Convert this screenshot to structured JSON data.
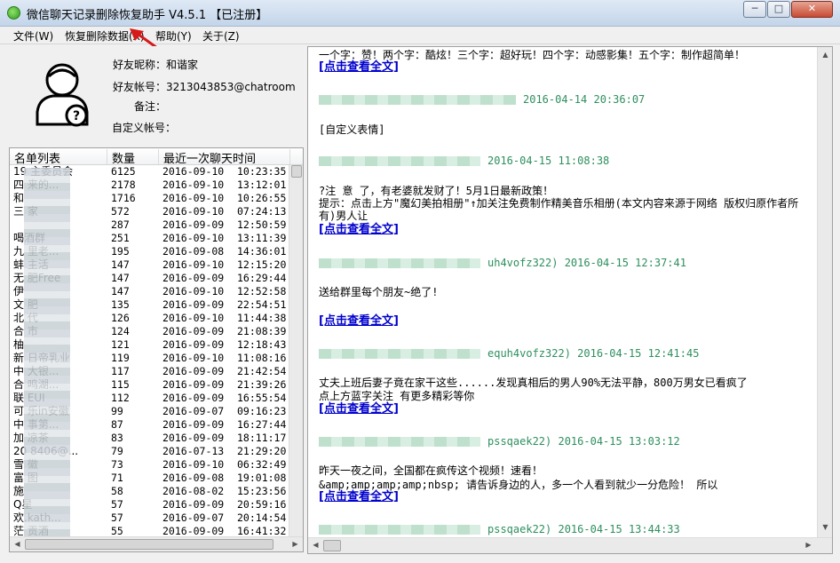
{
  "window": {
    "title": "微信聊天记录删除恢复助手 V4.5.1 【已注册】",
    "min_label": "─",
    "max_label": "□",
    "close_label": "✕"
  },
  "menu": [
    "文件(W)",
    "恢复删除数据(X)",
    "帮助(Y)",
    "关于(Z)"
  ],
  "profile": {
    "nickname_label": "好友昵称：",
    "nickname": "和谐家",
    "account_label": "好友帐号：",
    "account": "3213043853@chatroom",
    "note_label": "备注：",
    "note": "",
    "custom_label": "自定义帐号：",
    "custom": ""
  },
  "list": {
    "headers": [
      "名单列表",
      "数量",
      "最近一次聊天时间"
    ],
    "rows": [
      [
        "19  主委员会",
        "6125",
        "2016-09-10",
        "10:23:35"
      ],
      [
        "四  来的...",
        "2178",
        "2016-09-10",
        "13:12:01"
      ],
      [
        "和",
        "1716",
        "2016-09-10",
        "10:26:55"
      ],
      [
        "三  家",
        "572",
        "2016-09-10",
        "07:24:13"
      ],
      [
        "",
        "287",
        "2016-09-09",
        "12:50:59"
      ],
      [
        "  喝酒群",
        "251",
        "2016-09-10",
        "13:11:39"
      ],
      [
        "九  里老...",
        "195",
        "2016-09-08",
        "14:36:01"
      ],
      [
        "蚌  主活",
        "147",
        "2016-09-10",
        "12:15:20"
      ],
      [
        "无  肥Free",
        "147",
        "2016-09-09",
        "16:29:44"
      ],
      [
        "伊",
        "147",
        "2016-09-10",
        "12:52:58"
      ],
      [
        "文  肥",
        "135",
        "2016-09-09",
        "22:54:51"
      ],
      [
        "北  代",
        "126",
        "2016-09-10",
        "11:44:38"
      ],
      [
        "合  市",
        "124",
        "2016-09-09",
        "21:08:39"
      ],
      [
        "柚",
        "121",
        "2016-09-09",
        "12:18:43"
      ],
      [
        "新  日帝乳业",
        "119",
        "2016-09-10",
        "11:08:16"
      ],
      [
        "中  大银...",
        "117",
        "2016-09-09",
        "21:42:54"
      ],
      [
        "合  鸣湖...",
        "115",
        "2016-09-09",
        "21:39:26"
      ],
      [
        "联  EUI",
        "112",
        "2016-09-09",
        "16:55:54"
      ],
      [
        "可  乐in安徽",
        "99",
        "2016-09-07",
        "09:16:23"
      ],
      [
        "中  事第...",
        "87",
        "2016-09-09",
        "16:27:44"
      ],
      [
        "加  凉茶",
        "83",
        "2016-09-09",
        "18:11:17"
      ],
      [
        "20  8406@...",
        "79",
        "2016-07-13",
        "21:29:20"
      ],
      [
        "雪  徽",
        "73",
        "2016-09-10",
        "06:32:49"
      ],
      [
        "富  图",
        "71",
        "2016-09-08",
        "19:01:08"
      ],
      [
        "施",
        "58",
        "2016-08-02",
        "15:23:56"
      ],
      [
        "  Q星",
        "57",
        "2016-09-09",
        "20:59:16"
      ],
      [
        "  欢.kath...",
        "57",
        "2016-09-07",
        "20:14:54"
      ],
      [
        "茫  贡酒",
        "55",
        "2016-09-09",
        "16:41:32"
      ]
    ]
  },
  "messages": {
    "line1": "一个字：赞！两个字：酷炫！三个字：超好玩！四个字：动感影集！五个字：制作超简单！",
    "view_full": "[点击查看全文]",
    "h1": "2016-04-14 20:36:07",
    "emoji_label": "[自定义表情]",
    "h2": "2016-04-15 11:08:38",
    "line2": "?注 意 了，有老婆就发财了！5月1日最新政策！",
    "line3": "提示：点击上方\"魔幻美拍相册\"↑加关注免费制作精美音乐相册(本文内容来源于网络 版权归原作者所有)男人让",
    "h3": "uh4vofz322) 2016-04-15 12:37:41",
    "line4": "送给群里每个朋友~绝了!",
    "h4": "equh4vofz322) 2016-04-15 12:41:45",
    "line5": "丈夫上班后妻子竟在家干这些......发现真相后的男人90%无法平静，800万男女已看疯了",
    "line6": "点上方蓝字关注 有更多精彩等你",
    "h5": "pssqaek22) 2016-04-15 13:03:12",
    "line7": "昨天一夜之间，全国都在疯传这个视频！速看！",
    "line8": "&amp;amp;amp;amp;nbsp; 请告诉身边的人，多一个人看到就少一分危险！ 所以",
    "h6": "pssqaek22) 2016-04-15 13:44:33"
  }
}
